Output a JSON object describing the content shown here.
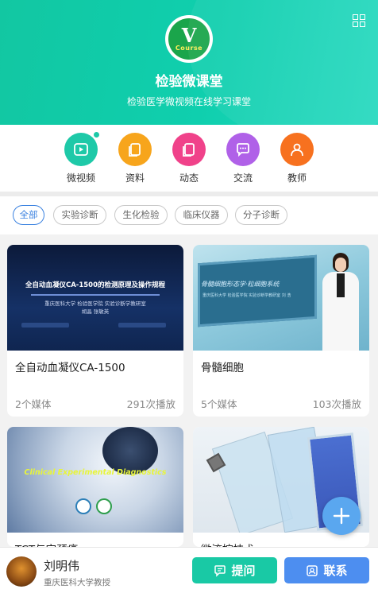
{
  "header": {
    "logo_letter": "V",
    "logo_word": "Course",
    "title": "检验微课堂",
    "subtitle": "检验医学微视频在线学习课堂"
  },
  "nav": {
    "items": [
      {
        "label": "微视频",
        "icon": "video-icon",
        "color": "#1ec9a8",
        "badge": true
      },
      {
        "label": "资料",
        "icon": "document-icon",
        "color": "#f7a51c"
      },
      {
        "label": "动态",
        "icon": "dynamic-icon",
        "color": "#f0428a"
      },
      {
        "label": "交流",
        "icon": "chat-icon",
        "color": "#b061e8"
      },
      {
        "label": "教师",
        "icon": "teacher-icon",
        "color": "#f7711f"
      }
    ]
  },
  "filters": [
    "全部",
    "实验诊断",
    "生化检验",
    "临床仪器",
    "分子诊断"
  ],
  "cards": [
    {
      "title": "全自动血凝仪CA-1500",
      "media": "2个媒体",
      "plays": "291次播放",
      "thumb_title": "全自动血凝仪CA-1500的检测原理及操作规程",
      "thumb_sub1": "重庆医科大学 检验医学院 实验诊断学教研室",
      "thumb_sub2": "胡晶  张敏英"
    },
    {
      "title": "骨髓细胞",
      "media": "5个媒体",
      "plays": "103次播放",
      "thumb_title": "骨髓细胞形态学·粒细胞系统",
      "thumb_sub1": "重庆医科大学 检验医学院 实验诊断学教研室 刘  浩"
    },
    {
      "title": "TCT与宫颈癌",
      "thumb_title": "Clinical Experimental Diagnostics"
    },
    {
      "title": "微流控技术"
    }
  ],
  "teacher": {
    "name": "刘明伟",
    "org": "重庆医科大学教授"
  },
  "actions": {
    "ask": "提问",
    "contact": "联系"
  }
}
